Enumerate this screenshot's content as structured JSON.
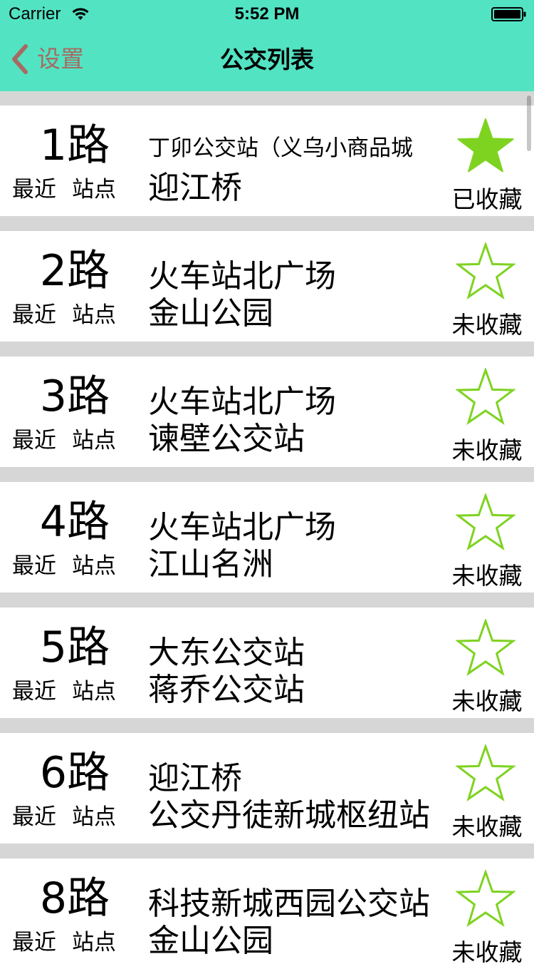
{
  "status_bar": {
    "carrier": "Carrier",
    "time": "5:52 PM",
    "wifi_icon": "wifi-icon",
    "battery_icon": "battery-icon"
  },
  "nav": {
    "back_label": "设置",
    "back_icon": "chevron-left-icon",
    "title": "公交列表"
  },
  "colors": {
    "header_bg": "#52e3c3",
    "back_tint": "#a66b63",
    "star_green": "#7ed321",
    "separator": "#d6d6d6"
  },
  "routes": [
    {
      "name": "1路",
      "label_recent": "最近",
      "label_stop": "站点",
      "stop1": "丁卯公交站（义乌小商品城",
      "stop2": "迎江桥",
      "favorited": true,
      "fav_label": "已收藏"
    },
    {
      "name": "2路",
      "label_recent": "最近",
      "label_stop": "站点",
      "stop1": "火车站北广场",
      "stop2": "金山公园",
      "favorited": false,
      "fav_label": "未收藏"
    },
    {
      "name": "3路",
      "label_recent": "最近",
      "label_stop": "站点",
      "stop1": "火车站北广场",
      "stop2": "谏壁公交站",
      "favorited": false,
      "fav_label": "未收藏"
    },
    {
      "name": "4路",
      "label_recent": "最近",
      "label_stop": "站点",
      "stop1": "火车站北广场",
      "stop2": "江山名洲",
      "favorited": false,
      "fav_label": "未收藏"
    },
    {
      "name": "5路",
      "label_recent": "最近",
      "label_stop": "站点",
      "stop1": "大东公交站",
      "stop2": "蒋乔公交站",
      "favorited": false,
      "fav_label": "未收藏"
    },
    {
      "name": "6路",
      "label_recent": "最近",
      "label_stop": "站点",
      "stop1": "迎江桥",
      "stop2": "公交丹徒新城枢纽站",
      "favorited": false,
      "fav_label": "未收藏"
    },
    {
      "name": "8路",
      "label_recent": "最近",
      "label_stop": "站点",
      "stop1": "科技新城西园公交站",
      "stop2": "金山公园",
      "favorited": false,
      "fav_label": "未收藏"
    }
  ]
}
